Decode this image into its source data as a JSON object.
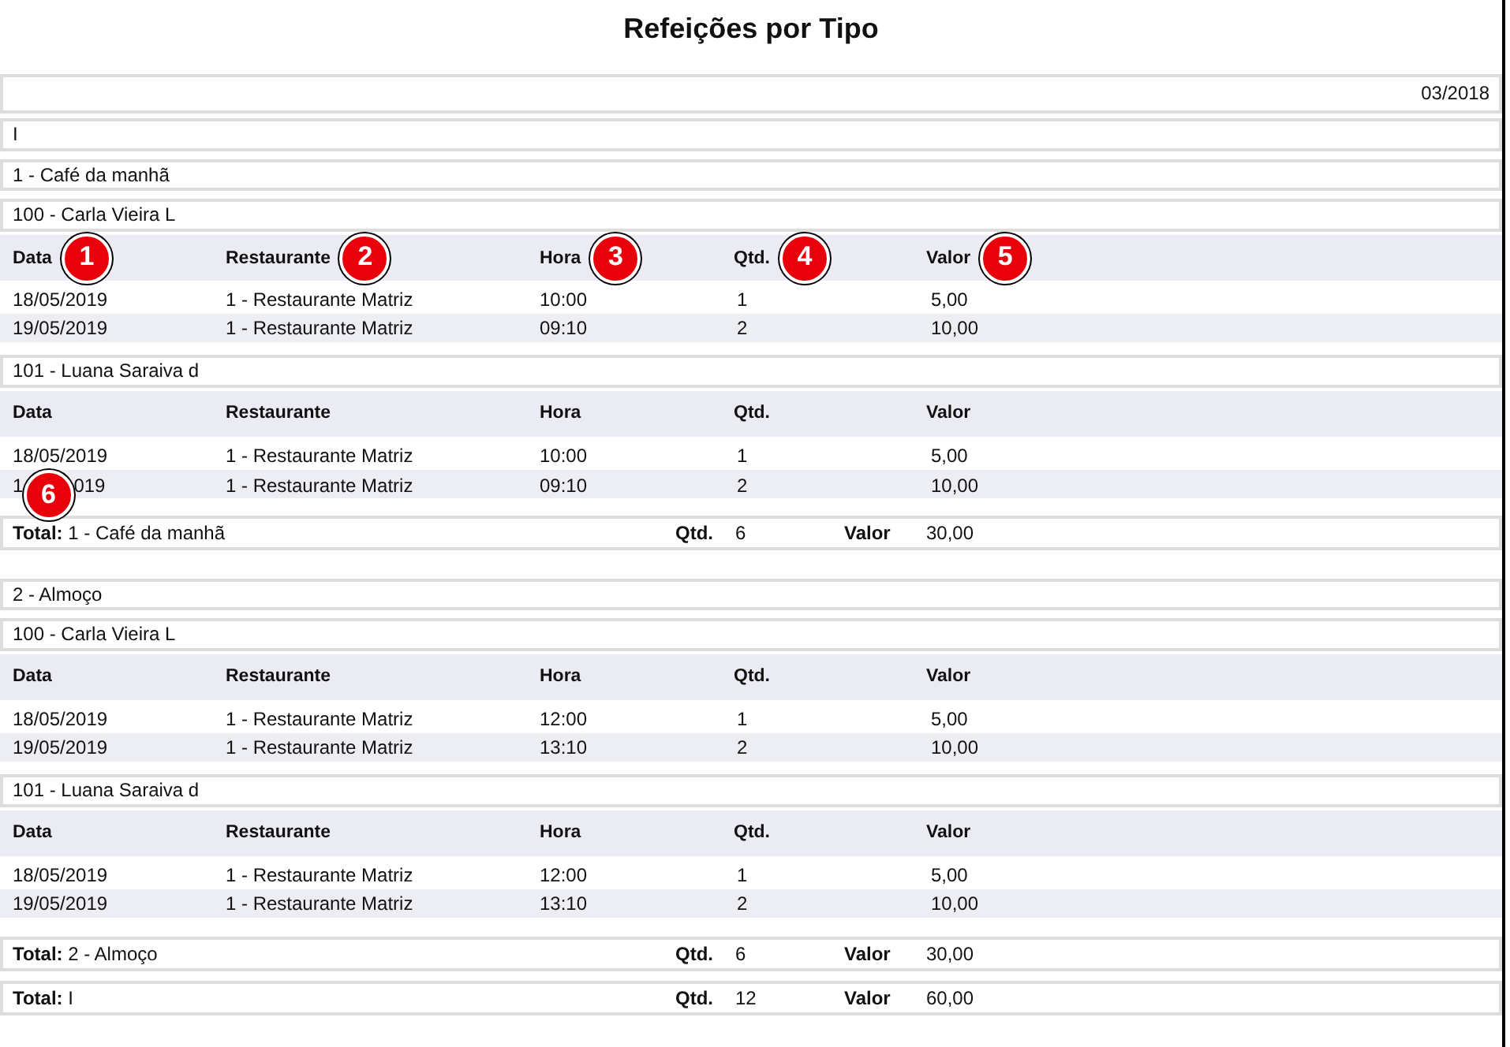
{
  "title": "Refeições por Tipo",
  "period": "03/2018",
  "group": "I",
  "types": [
    {
      "name": "1 - Café da manhã",
      "people": [
        {
          "name": "100 - Carla Vieira L",
          "columns": [
            {
              "label": "Data",
              "callout": "1"
            },
            {
              "label": "Restaurante",
              "callout": "2"
            },
            {
              "label": "Hora",
              "callout": "3"
            },
            {
              "label": "Qtd.",
              "callout": "4"
            },
            {
              "label": "Valor",
              "callout": "5"
            }
          ],
          "rows": [
            {
              "date": "18/05/2019",
              "restaurant": "1 - Restaurante Matriz",
              "time": "10:00",
              "qty": "1",
              "value": "5,00"
            },
            {
              "date": "19/05/2019",
              "restaurant": "1 - Restaurante Matriz",
              "time": "09:10",
              "qty": "2",
              "value": "10,00"
            }
          ]
        },
        {
          "name": "101 - Luana Saraiva d",
          "columns": [
            {
              "label": "Data"
            },
            {
              "label": "Restaurante"
            },
            {
              "label": "Hora"
            },
            {
              "label": "Qtd."
            },
            {
              "label": "Valor"
            }
          ],
          "rows": [
            {
              "date": "18/05/2019",
              "restaurant": "1 - Restaurante Matriz",
              "time": "10:00",
              "qty": "1",
              "value": "5,00"
            },
            {
              "date_parts": [
                "1",
                "019"
              ],
              "restaurant": "1 - Restaurante Matriz",
              "time": "09:10",
              "qty": "2",
              "value": "10,00",
              "callout": "6"
            }
          ]
        }
      ],
      "total": {
        "label": "**Total:** 1 - Café da manhã",
        "qty_label": "Qtd.",
        "qty": "6",
        "value_label": "Valor",
        "value": "30,00"
      }
    },
    {
      "name": "2 - Almoço",
      "people": [
        {
          "name": "100 - Carla Vieira L",
          "columns": [
            {
              "label": "Data"
            },
            {
              "label": "Restaurante"
            },
            {
              "label": "Hora"
            },
            {
              "label": "Qtd."
            },
            {
              "label": "Valor"
            }
          ],
          "rows": [
            {
              "date": "18/05/2019",
              "restaurant": "1 - Restaurante Matriz",
              "time": "12:00",
              "qty": "1",
              "value": "5,00"
            },
            {
              "date": "19/05/2019",
              "restaurant": "1 - Restaurante Matriz",
              "time": "13:10",
              "qty": "2",
              "value": "10,00"
            }
          ]
        },
        {
          "name": "101 - Luana Saraiva d",
          "columns": [
            {
              "label": "Data"
            },
            {
              "label": "Restaurante"
            },
            {
              "label": "Hora"
            },
            {
              "label": "Qtd."
            },
            {
              "label": "Valor"
            }
          ],
          "rows": [
            {
              "date": "18/05/2019",
              "restaurant": "1 - Restaurante Matriz",
              "time": "12:00",
              "qty": "1",
              "value": "5,00"
            },
            {
              "date": "19/05/2019",
              "restaurant": "1 - Restaurante Matriz",
              "time": "13:10",
              "qty": "2",
              "value": "10,00"
            }
          ]
        }
      ],
      "total": {
        "label": "**Total:** 2 - Almoço",
        "qty_label": "Qtd.",
        "qty": "6",
        "value_label": "Valor",
        "value": "30,00"
      }
    }
  ],
  "grand_total": {
    "label": "**Total:** I",
    "qty_label": "Qtd.",
    "qty": "12",
    "value_label": "Valor",
    "value": "60,00"
  }
}
